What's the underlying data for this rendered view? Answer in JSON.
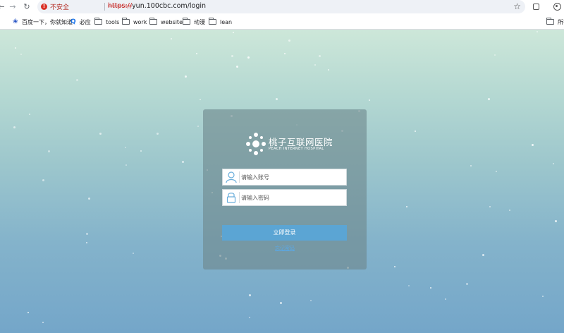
{
  "browser": {
    "security_label": "不安全",
    "url_scheme": "https://",
    "url_rest": "yun.100cbc.com/login"
  },
  "bookmarks": [
    {
      "label": "百度一下，你就知道",
      "icon": "baidu-paw-icon"
    },
    {
      "label": "必应",
      "icon": "bing-search-icon"
    },
    {
      "label": "tools",
      "icon": "folder-icon"
    },
    {
      "label": "work",
      "icon": "folder-icon"
    },
    {
      "label": "website",
      "icon": "folder-icon"
    },
    {
      "label": "动漫",
      "icon": "folder-icon"
    },
    {
      "label": "lean",
      "icon": "folder-icon"
    },
    {
      "label": "所有",
      "icon": "folder-icon"
    }
  ],
  "login": {
    "logo_name": "桃子互联网医院",
    "logo_sub": "PEACH INTERNET HOSPITAL",
    "username_placeholder": "请输入账号",
    "password_placeholder": "请输入密码",
    "login_button": "立即登录",
    "forgot_link": "忘记密码"
  },
  "colors": {
    "login_button": "#5ba5d4",
    "card_overlay": "#6e878c",
    "forgot_link": "#5aa8e6"
  }
}
